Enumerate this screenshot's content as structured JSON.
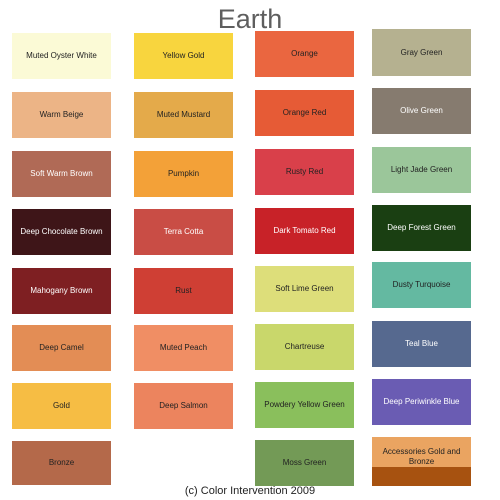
{
  "title": "Earth",
  "copyright": "(c) Color Intervention 2009",
  "swatches": [
    {
      "label": "Muted Oyster White",
      "color": "#fbfad6",
      "text_color": "#222222"
    },
    {
      "label": "Warm Beige",
      "color": "#ecb486",
      "text_color": "#222222"
    },
    {
      "label": "Soft Warm Brown",
      "color": "#b06a56",
      "text_color": "#ffffff"
    },
    {
      "label": "Deep Chocolate Brown",
      "color": "#3e1518",
      "text_color": "#ffffff"
    },
    {
      "label": "Mahogany Brown",
      "color": "#7e1f22",
      "text_color": "#ffffff"
    },
    {
      "label": "Deep Camel",
      "color": "#e38d55",
      "text_color": "#222222"
    },
    {
      "label": "Gold",
      "color": "#f6bd44",
      "text_color": "#222222"
    },
    {
      "label": "Bronze",
      "color": "#b4694a",
      "text_color": "#222222"
    },
    {
      "label": "Yellow Gold",
      "color": "#f8d53e",
      "text_color": "#222222"
    },
    {
      "label": "Muted Mustard",
      "color": "#e4aa4a",
      "text_color": "#222222"
    },
    {
      "label": "Pumpkin",
      "color": "#f3a138",
      "text_color": "#222222"
    },
    {
      "label": "Terra Cotta",
      "color": "#c94d45",
      "text_color": "#ffffff"
    },
    {
      "label": "Rust",
      "color": "#cf3f34",
      "text_color": "#222222"
    },
    {
      "label": "Muted Peach",
      "color": "#f08e64",
      "text_color": "#222222"
    },
    {
      "label": "Deep Salmon",
      "color": "#ec845e",
      "text_color": "#222222"
    },
    {
      "label": "Orange",
      "color": "#ea6640",
      "text_color": "#222222"
    },
    {
      "label": "Orange Red",
      "color": "#e65b36",
      "text_color": "#222222"
    },
    {
      "label": "Rusty Red",
      "color": "#d9404a",
      "text_color": "#222222"
    },
    {
      "label": "Dark Tomato Red",
      "color": "#c82228",
      "text_color": "#ffffff"
    },
    {
      "label": "Soft Lime Green",
      "color": "#ddde7a",
      "text_color": "#222222"
    },
    {
      "label": "Chartreuse",
      "color": "#c9d76b",
      "text_color": "#222222"
    },
    {
      "label": "Powdery Yellow Green",
      "color": "#8abf5c",
      "text_color": "#222222"
    },
    {
      "label": "Moss Green",
      "color": "#739a56",
      "text_color": "#222222"
    },
    {
      "label": "Gray Green",
      "color": "#b5b190",
      "text_color": "#222222"
    },
    {
      "label": "Olive Green",
      "color": "#867b6f",
      "text_color": "#ffffff"
    },
    {
      "label": "Light Jade Green",
      "color": "#9bc69a",
      "text_color": "#222222"
    },
    {
      "label": "Deep Forest Green",
      "color": "#1a3f12",
      "text_color": "#ffffff"
    },
    {
      "label": "Dusty Turquoise",
      "color": "#64b9a1",
      "text_color": "#222222"
    },
    {
      "label": "Teal Blue",
      "color": "#56698f",
      "text_color": "#ffffff"
    },
    {
      "label": "Deep Periwinkle Blue",
      "color": "#6a5cb3",
      "text_color": "#ffffff"
    },
    {
      "label": "Accessories Gold and Bronze",
      "color": "#eaa461",
      "color_bottom": "#a75210",
      "text_color": "#222222"
    }
  ]
}
